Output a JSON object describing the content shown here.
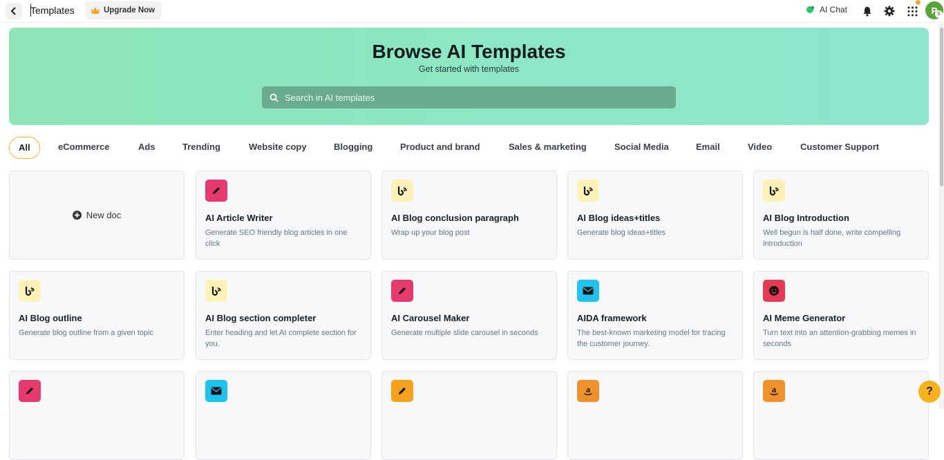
{
  "header": {
    "title": "Templates",
    "upgrade_label": "Upgrade Now",
    "ai_chat_label": "AI Chat",
    "avatar_initial": "P",
    "avatar_badge": "S"
  },
  "hero": {
    "title": "Browse AI Templates",
    "subtitle": "Get started with templates",
    "search_placeholder": "Search in AI templates"
  },
  "tabs": [
    "All",
    "eCommerce",
    "Ads",
    "Trending",
    "Website copy",
    "Blogging",
    "Product and brand",
    "Sales & marketing",
    "Social Media",
    "Email",
    "Video",
    "Customer Support"
  ],
  "new_doc_label": "New doc",
  "cards": [
    {
      "title": "AI Article Writer",
      "desc": "Generate SEO friendly blog articles in one click",
      "icon": "pencil-icon",
      "color": "#e63a6f"
    },
    {
      "title": "AI Blog conclusion paragraph",
      "desc": "Wrap up your blog post",
      "icon": "blog-icon",
      "color": "#fdf3b8"
    },
    {
      "title": "AI Blog ideas+titles",
      "desc": "Generate blog ideas+titles",
      "icon": "blog-icon",
      "color": "#fdf3b8"
    },
    {
      "title": "AI Blog Introduction",
      "desc": "Well begun is half done, write compelling introduction",
      "icon": "blog-icon",
      "color": "#fdf3b8"
    },
    {
      "title": "AI Blog outline",
      "desc": "Generate blog outline from a given topic",
      "icon": "blog-icon",
      "color": "#fdf3b8"
    },
    {
      "title": "AI Blog section completer",
      "desc": "Enter heading and let AI complete section for you.",
      "icon": "blog-icon",
      "color": "#fdf3b8"
    },
    {
      "title": "AI Carousel Maker",
      "desc": "Generate multiple slide carousel in seconds",
      "icon": "pencil-icon",
      "color": "#e63a6f"
    },
    {
      "title": "AIDA framework",
      "desc": "The best-known marketing model for tracing the customer journey.",
      "icon": "email-icon",
      "color": "#1ec3f0"
    },
    {
      "title": "AI Meme Generator",
      "desc": "Turn text into an attention-grabbing memes in seconds",
      "icon": "smiley-icon",
      "color": "#e63a55"
    },
    {
      "title": "",
      "desc": "",
      "icon": "pencil-icon",
      "color": "#e63a6f"
    },
    {
      "title": "",
      "desc": "",
      "icon": "email-icon",
      "color": "#1ec3f0"
    },
    {
      "title": "",
      "desc": "",
      "icon": "pencil-icon",
      "color": "#f6a11a"
    },
    {
      "title": "",
      "desc": "",
      "icon": "amazon-icon",
      "color": "#f0922b"
    },
    {
      "title": "",
      "desc": "",
      "icon": "amazon-icon",
      "color": "#f0922b"
    }
  ],
  "help_label": "?",
  "colors": {
    "accent": "#f2b233",
    "hero": "#8ee6c2",
    "search": "#6aac90"
  }
}
